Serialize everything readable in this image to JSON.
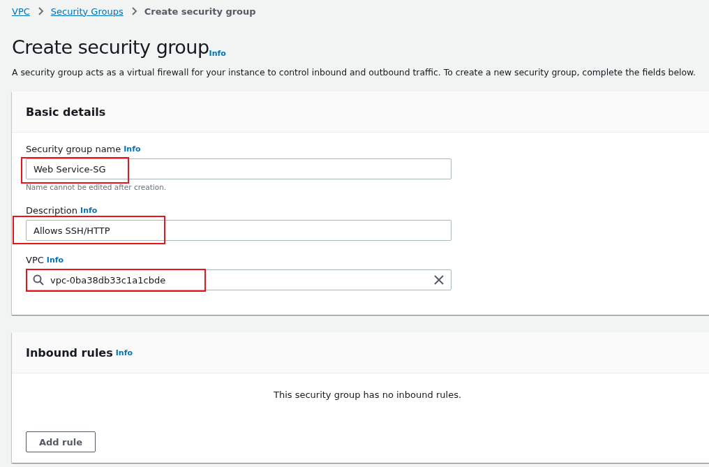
{
  "breadcrumb": [
    {
      "label": "VPC",
      "kind": "link"
    },
    {
      "label": "Security Groups",
      "kind": "link"
    },
    {
      "label": "Create security group",
      "kind": "current"
    }
  ],
  "page": {
    "title": "Create security group",
    "info": "Info",
    "description": "A security group acts as a virtual firewall for your instance to control inbound and outbound traffic. To create a new security group, complete the fields below."
  },
  "basic_details": {
    "title": "Basic details",
    "fields": [
      {
        "label": "Security group name",
        "info": "Info",
        "value": "Web Service-SG",
        "hint": "Name cannot be edited after creation.",
        "kind": "text",
        "highlighted": true
      },
      {
        "label": "Description",
        "info": "Info",
        "value": "Allows SSH/HTTP",
        "kind": "text",
        "highlighted": true
      },
      {
        "label": "VPC",
        "info": "Info",
        "value": "vpc-0ba38db33c1a1cbde",
        "kind": "search",
        "highlighted": true
      }
    ]
  },
  "inbound_rules": {
    "title": "Inbound rules",
    "info": "Info",
    "empty_text": "This security group has no inbound rules.",
    "button": "Add rule"
  }
}
